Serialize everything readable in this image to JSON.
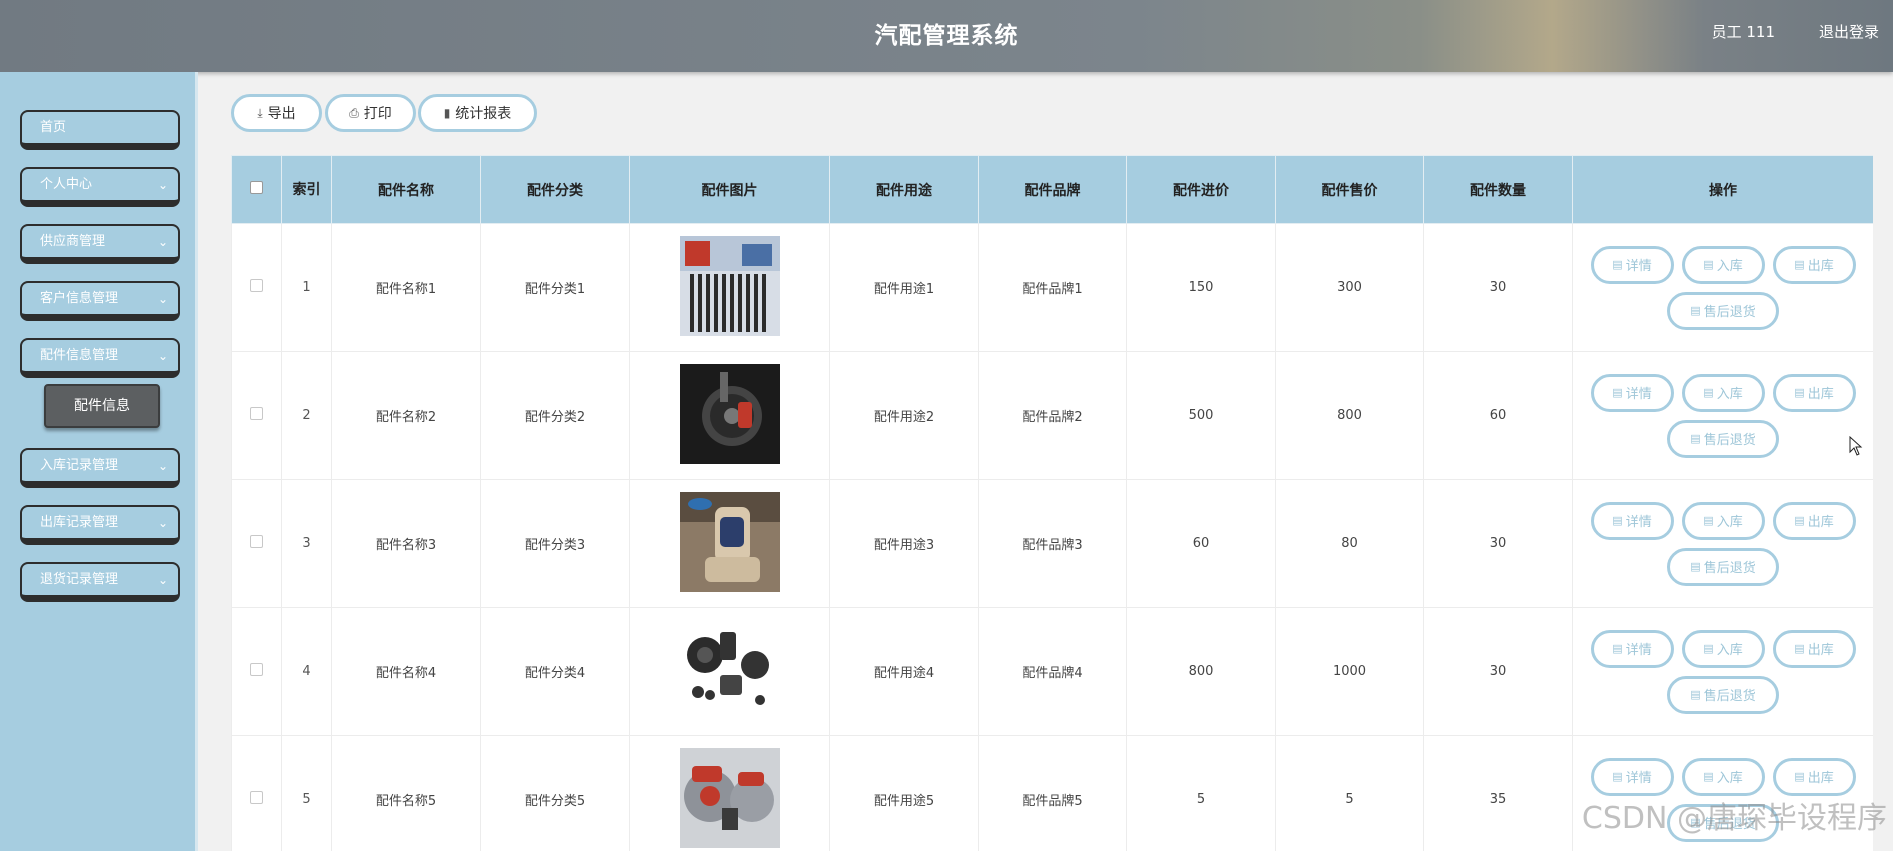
{
  "header": {
    "title": "汽配管理系统",
    "user": "员工  111",
    "logout": "退出登录"
  },
  "sidebar": {
    "items": [
      {
        "label": "首页",
        "chevron": false
      },
      {
        "label": "个人中心",
        "chevron": true
      },
      {
        "label": "供应商管理",
        "chevron": true
      },
      {
        "label": "客户信息管理",
        "chevron": true
      },
      {
        "label": "配件信息管理",
        "chevron": true
      },
      {
        "label": "入库记录管理",
        "chevron": true
      },
      {
        "label": "出库记录管理",
        "chevron": true
      },
      {
        "label": "退货记录管理",
        "chevron": true
      }
    ],
    "submenu": {
      "label": "配件信息"
    }
  },
  "toolbar": {
    "export": "导出",
    "print": "打印",
    "report": "统计报表"
  },
  "table": {
    "headers": [
      "索引",
      "配件名称",
      "配件分类",
      "配件图片",
      "配件用途",
      "配件品牌",
      "配件进价",
      "配件售价",
      "配件数量",
      "操作"
    ],
    "ops": {
      "detail": "详情",
      "stock_in": "入库",
      "stock_out": "出库",
      "return": "售后退货"
    },
    "rows": [
      {
        "index": "1",
        "name": "配件名称1",
        "category": "配件分类1",
        "image": "tools-image",
        "usage": "配件用途1",
        "brand": "配件品牌1",
        "cost": "150",
        "price": "300",
        "qty": "30"
      },
      {
        "index": "2",
        "name": "配件名称2",
        "category": "配件分类2",
        "image": "brake-disc-image",
        "usage": "配件用途2",
        "brand": "配件品牌2",
        "cost": "500",
        "price": "800",
        "qty": "60"
      },
      {
        "index": "3",
        "name": "配件名称3",
        "category": "配件分类3",
        "image": "car-seat-image",
        "usage": "配件用途3",
        "brand": "配件品牌3",
        "cost": "60",
        "price": "80",
        "qty": "30"
      },
      {
        "index": "4",
        "name": "配件名称4",
        "category": "配件分类4",
        "image": "speaker-set-image",
        "usage": "配件用途4",
        "brand": "配件品牌4",
        "cost": "800",
        "price": "1000",
        "qty": "30"
      },
      {
        "index": "5",
        "name": "配件名称5",
        "category": "配件分类5",
        "image": "brake-caliper-image",
        "usage": "配件用途5",
        "brand": "配件品牌5",
        "cost": "5",
        "price": "5",
        "qty": "35"
      }
    ]
  },
  "watermark": "CSDN @唐琛毕设程序"
}
